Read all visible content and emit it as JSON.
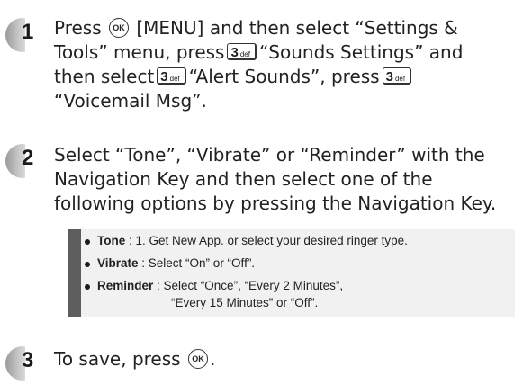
{
  "steps": [
    {
      "number": "1",
      "line1_a": "Press",
      "line1_key": "OK",
      "line1_b": "[MENU] and then select “Settings &",
      "line2_a": "Tools” menu, press",
      "line2_key_num": "3",
      "line2_key_sub": "def",
      "line2_b": "“Sounds Settings” and",
      "line3_a": "then select",
      "line3_key_num": "3",
      "line3_key_sub": "def",
      "line3_b": "“Alert Sounds”, press",
      "line3_key2_num": "3",
      "line3_key2_sub": "def",
      "line4": "“Voicemail Msg”."
    },
    {
      "number": "2",
      "line1": "Select “Tone”, “Vibrate” or “Reminder” with the",
      "line2": "Navigation Key and then select one of the",
      "line3": "following options by pressing the Navigation Key."
    },
    {
      "number": "3",
      "line1_a": "To save, press",
      "line1_key": "OK",
      "line1_b": "."
    }
  ],
  "options": [
    {
      "label": "Tone",
      "text": " : 1. Get New App. or select your desired ringer type."
    },
    {
      "label": "Vibrate",
      "text": " : Select “On” or “Off”."
    },
    {
      "label": "Reminder",
      "text": " : Select “Once”, “Every 2 Minutes”,",
      "continuation": "“Every 15 Minutes” or “Off”."
    }
  ]
}
